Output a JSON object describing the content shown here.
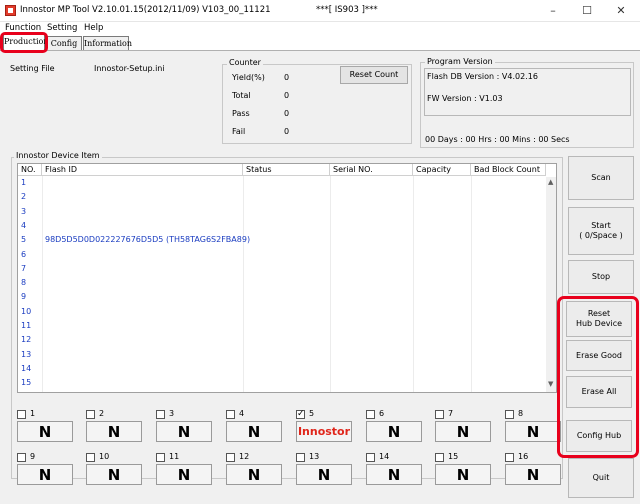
{
  "window": {
    "title": "Innostor MP Tool V2.10.01.15(2012/11/09)   V103_00_11121",
    "title_right": "***[ IS903 ]***"
  },
  "window_controls": {
    "minimize": "–",
    "maximize": "☐",
    "close": "✕"
  },
  "menu": [
    "Function",
    "Setting",
    "Help"
  ],
  "tabs": [
    "Production",
    "Config",
    "Information"
  ],
  "setting_file": {
    "label": "Setting File",
    "value": "Innostor-Setup.ini"
  },
  "counter": {
    "title": "Counter",
    "items": [
      {
        "label": "Yield(%)",
        "value": "0"
      },
      {
        "label": "Total",
        "value": "0"
      },
      {
        "label": "Pass",
        "value": "0"
      },
      {
        "label": "Fail",
        "value": "0"
      }
    ],
    "reset_label": "Reset Count"
  },
  "program_version": {
    "title": "Program Version",
    "flash_db": "Flash DB Version :  V4.02.16",
    "fw": "FW Version :   V1.03",
    "timer": "00 Days : 00 Hrs : 00 Mins : 00 Secs"
  },
  "device_group": "Innostor Device Item",
  "table": {
    "columns": [
      "NO.",
      "Flash ID",
      "Status",
      "Serial NO.",
      "Capacity",
      "Bad Block Count"
    ],
    "rows": [
      {
        "no": "1",
        "flash_id": ""
      },
      {
        "no": "2",
        "flash_id": ""
      },
      {
        "no": "3",
        "flash_id": ""
      },
      {
        "no": "4",
        "flash_id": ""
      },
      {
        "no": "5",
        "flash_id": "98D5D5D0D022227676D5D5 (TH58TAG6S2FBA89)"
      },
      {
        "no": "6",
        "flash_id": ""
      },
      {
        "no": "7",
        "flash_id": ""
      },
      {
        "no": "8",
        "flash_id": ""
      },
      {
        "no": "9",
        "flash_id": ""
      },
      {
        "no": "10",
        "flash_id": ""
      },
      {
        "no": "11",
        "flash_id": ""
      },
      {
        "no": "12",
        "flash_id": ""
      },
      {
        "no": "13",
        "flash_id": ""
      },
      {
        "no": "14",
        "flash_id": ""
      },
      {
        "no": "15",
        "flash_id": ""
      }
    ]
  },
  "slots": [
    {
      "num": "1",
      "checked": false,
      "label": "N"
    },
    {
      "num": "2",
      "checked": false,
      "label": "N"
    },
    {
      "num": "3",
      "checked": false,
      "label": "N"
    },
    {
      "num": "4",
      "checked": false,
      "label": "N"
    },
    {
      "num": "5",
      "checked": true,
      "label": "Innostor"
    },
    {
      "num": "6",
      "checked": false,
      "label": "N"
    },
    {
      "num": "7",
      "checked": false,
      "label": "N"
    },
    {
      "num": "8",
      "checked": false,
      "label": "N"
    },
    {
      "num": "9",
      "checked": false,
      "label": "N"
    },
    {
      "num": "10",
      "checked": false,
      "label": "N"
    },
    {
      "num": "11",
      "checked": false,
      "label": "N"
    },
    {
      "num": "12",
      "checked": false,
      "label": "N"
    },
    {
      "num": "13",
      "checked": false,
      "label": "N"
    },
    {
      "num": "14",
      "checked": false,
      "label": "N"
    },
    {
      "num": "15",
      "checked": false,
      "label": "N"
    },
    {
      "num": "16",
      "checked": false,
      "label": "N"
    }
  ],
  "side_buttons": {
    "scan": "Scan",
    "start_line1": "Start",
    "start_line2": "( 0/Space )",
    "stop": "Stop",
    "reset_line1": "Reset",
    "reset_line2": "Hub Device",
    "erase_good": "Erase Good",
    "erase_all": "Erase All",
    "config_hub": "Config Hub",
    "quit": "Quit"
  },
  "colors": {
    "highlight_red": "#e8001c",
    "text_blue": "#1a3cc0",
    "brand_red": "#e0261b"
  }
}
